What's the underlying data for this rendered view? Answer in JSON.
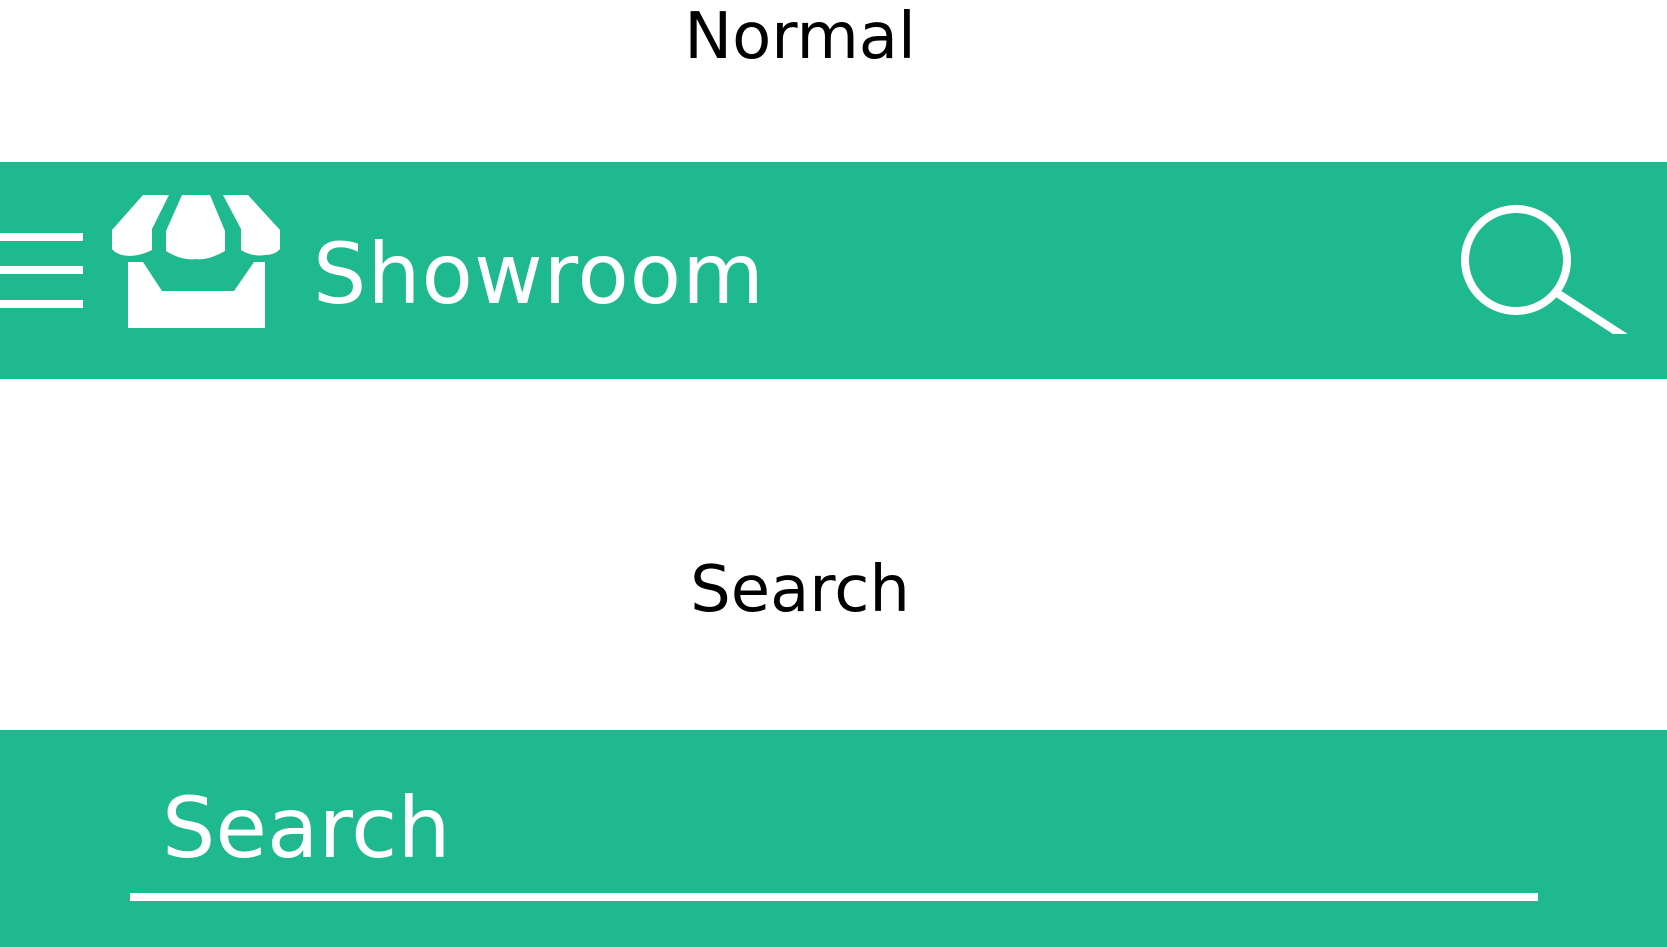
{
  "states": {
    "normal": {
      "caption": "Normal"
    },
    "search": {
      "caption": "Search"
    }
  },
  "appbar": {
    "title": "Showroom",
    "menu_icon": "hamburger-menu-icon",
    "logo_icon": "storefront-icon",
    "search_icon": "magnifier-icon",
    "color": "#1fb98f",
    "foreground": "#ffffff"
  },
  "search_bar": {
    "placeholder": "Search",
    "value": ""
  }
}
